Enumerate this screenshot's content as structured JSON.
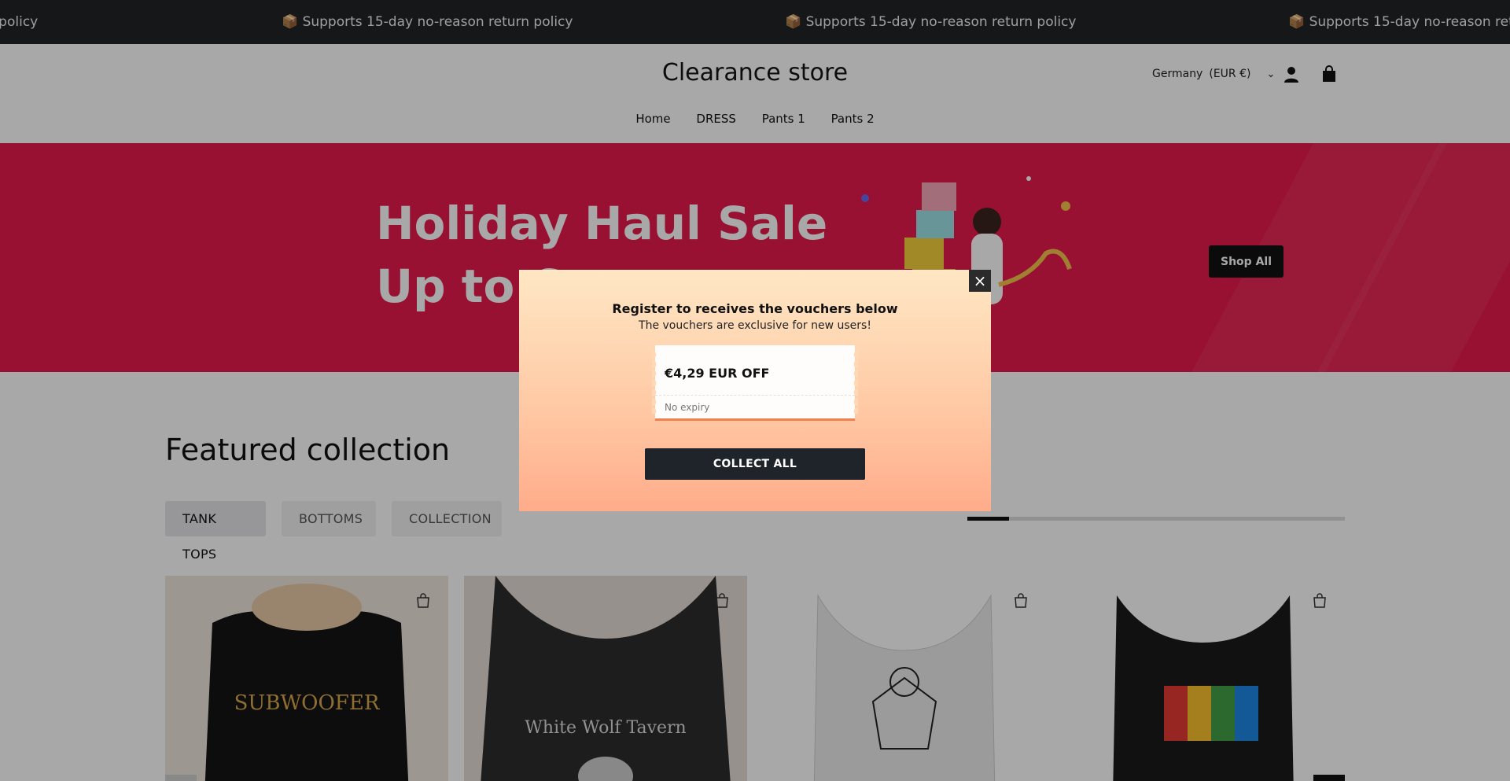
{
  "announcement": {
    "text_fragment": "n policy",
    "message": "📦 Supports 15-day no-reason return policy"
  },
  "header": {
    "logo": "Clearance store",
    "locale": "Germany",
    "currency": "(EUR €)",
    "account_icon": "user-icon",
    "cart_icon": "shopping-bag-icon"
  },
  "nav": {
    "items": [
      "Home",
      "DRESS",
      "Pants 1",
      "Pants 2"
    ]
  },
  "hero": {
    "line1": "Holiday Haul Sale",
    "line2": "Up to 6",
    "button": "Shop All",
    "background_color": "#e81a4c"
  },
  "featured": {
    "title": "Featured collection",
    "tabs": [
      "TANK TOPS",
      "BOTTOMS",
      "COLLECTION"
    ],
    "active_tab": 0,
    "slider_progress": 0.11
  },
  "products": [
    {
      "name_icon": "tank-top-black-print",
      "graphic_text": "SUBWOOFER",
      "quick_add_icon": "bag-plus-icon"
    },
    {
      "name_icon": "tank-top-grey-wolf",
      "graphic_text": "White Wolf Tavern",
      "quick_add_icon": "bag-plus-icon"
    },
    {
      "name_icon": "tank-top-white-dab-fox",
      "quick_add_icon": "bag-plus-icon"
    },
    {
      "name_icon": "tank-top-black-rainbow",
      "quick_add_icon": "bag-plus-icon"
    }
  ],
  "popup": {
    "title": "Register to receives the vouchers below",
    "subtitle": "The vouchers are exclusive for new users!",
    "voucher_amount": "€4,29 EUR OFF",
    "voucher_expiry": "No expiry",
    "button": "COLLECT ALL",
    "close_label": "×"
  }
}
